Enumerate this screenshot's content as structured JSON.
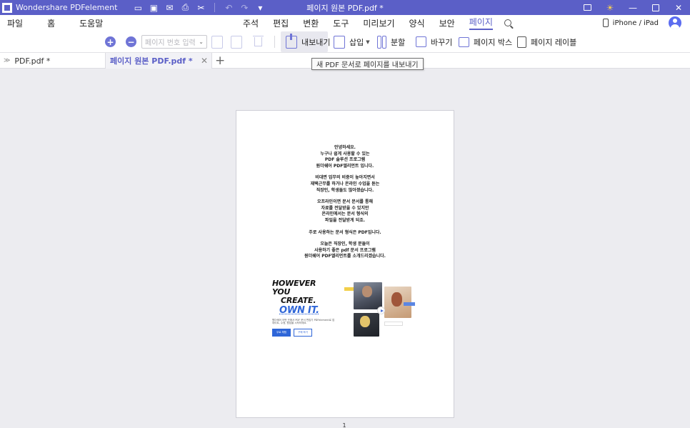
{
  "titlebar": {
    "app_name": "Wondershare PDFelement",
    "doc_title": "페이지 원본 PDF.pdf *"
  },
  "menu": {
    "left": [
      "파일",
      "홈",
      "도움말"
    ],
    "center": [
      "주석",
      "편집",
      "변환",
      "도구",
      "미리보기",
      "양식",
      "보안",
      "페이지"
    ],
    "active": "페이지",
    "device_label": "iPhone / iPad"
  },
  "toolbar": {
    "page_input_placeholder": "페이지 번호 입력",
    "export_label": "내보내기",
    "insert_label": "삽입",
    "split_label": "분할",
    "replace_label": "바꾸기",
    "page_box_label": "페이지 박스",
    "page_label_label": "페이지 레이블"
  },
  "tabs": [
    {
      "label": "PDF.pdf *",
      "active": false
    },
    {
      "label": "페이지 원본 PDF.pdf *",
      "active": true
    }
  ],
  "tooltip": "새 PDF 문서로 페이지를 내보내기",
  "document": {
    "paragraphs": [
      [
        "안녕하세요.",
        "누구나 쉽게 사용할 수 있는",
        "PDF 솔루션 프로그램",
        "원더쉐어 PDF엘리먼트 입니다."
      ],
      [
        "비대면 업무의 비중이 높아지면서",
        "재택근무를 하거나 온라인 수업을 듣는",
        "직장인, 학생들도 많아졌습니다."
      ],
      [
        "오프라인이면 문서 문서를 통해",
        "자료를 전달받을 수 있지만",
        "온라인에서는 문서 형식의",
        "파일을 전달받게 되죠."
      ],
      [
        "주로 사용하는 문서 형식은 PDF입니다."
      ],
      [
        "오늘은 직장인, 학생 분들이",
        "사용하기 좋은 pdf 문서 프로그램",
        "원더쉐어 PDF엘리먼트를 소개드리겠습니다."
      ]
    ],
    "ad": {
      "headline_1": "HOWEVER YOU",
      "headline_2": "CREATE.",
      "headline_3": "OWN IT.",
      "small_text": "원더쉐어 어떤 곳에서 PDF 문서 편집기 PDFelement로 업데이트, 수정, 협업을 시작하세요.",
      "primary_button": "무료 체험",
      "secondary_button": "구매 하기"
    },
    "page_number": "1"
  },
  "colors": {
    "accent": "#5b5fc7",
    "canvas": "#ececf0"
  }
}
